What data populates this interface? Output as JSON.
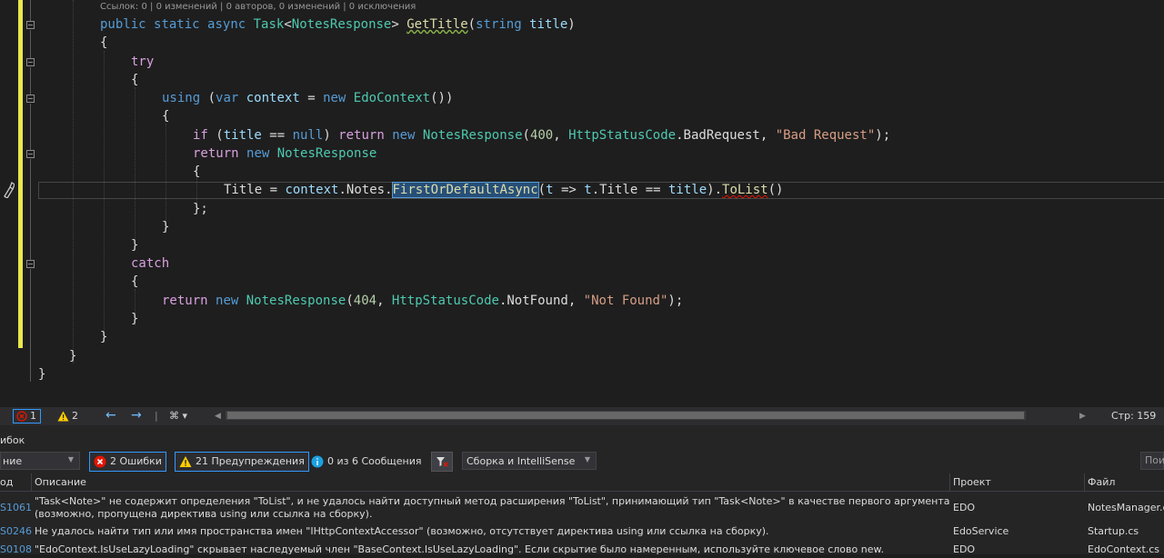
{
  "editor": {
    "codelens": "Ссылок: 0 | 0 изменений | 0 авторов, 0 изменений | 0 исключения",
    "lines": {
      "l1_kw1": "public",
      "l1_kw2": "static",
      "l1_kw3": "async",
      "l1_type": "Task",
      "l1_generic": "NotesResponse",
      "l1_method": "GetTitle",
      "l1_ptype": "string",
      "l1_pname": "title",
      "try_kw": "try",
      "using_kw": "using",
      "var_kw": "var",
      "context_var": "context",
      "new_kw": "new",
      "edo_type": "EdoContext",
      "if_kw": "if",
      "title_param": "title",
      "null_kw": "null",
      "return_kw": "return",
      "notes_resp": "NotesResponse",
      "num_400": "400",
      "http_status": "HttpStatusCode",
      "bad_request_member": "BadRequest",
      "bad_request_str": "\"Bad Request\"",
      "title_prop": "Title",
      "notes_prop": "Notes",
      "first_method": "FirstOrDefaultAsync",
      "lambda_t": "t",
      "lambda_title": "Title",
      "tolist_method": "ToList",
      "catch_kw": "catch",
      "num_404": "404",
      "not_found_member": "NotFound",
      "not_found_str": "\"Not Found\""
    }
  },
  "statusbar": {
    "errors_count": "1",
    "warnings_count": "2",
    "position": "Стр: 159"
  },
  "error_panel": {
    "title": "ибок",
    "filter_value": "ние",
    "errors_button": "2 Ошибки",
    "warnings_button": "21 Предупреждения",
    "messages_button": "0 из 6 Сообщения",
    "build_filter": "Сборка и IntelliSense",
    "search_placeholder": "Пои",
    "columns": {
      "code": "од",
      "description": "Описание",
      "project": "Проект",
      "file": "Файл"
    },
    "rows": [
      {
        "code": "S1061",
        "description": "\"Task<Note>\" не содержит определения \"ToList\", и не удалось найти доступный метод расширения \"ToList\", принимающий тип \"Task<Note>\" в качестве первого аргумента (возможно, пропущена директива using или ссылка на сборку).",
        "project": "EDO",
        "file": "NotesManager.c"
      },
      {
        "code": "S0246",
        "description": "Не удалось найти тип или имя пространства имен \"IHttpContextAccessor\" (возможно, отсутствует директива using или ссылка на сборку).",
        "project": "EdoService",
        "file": "Startup.cs"
      },
      {
        "code": "S0108",
        "description": "\"EdoContext.IsUseLazyLoading\" скрывает наследуемый член \"BaseContext.IsUseLazyLoading\". Если скрытие было намеренным, используйте ключевое слово new.",
        "project": "EDO",
        "file": "EdoContext.cs"
      }
    ]
  },
  "colors": {
    "background": "#1e1e1e",
    "keyword": "#569cd6",
    "control": "#d8a0df",
    "type": "#4ec9b0",
    "method": "#dcdcaa",
    "string": "#d69d85",
    "number": "#b5cea8",
    "changebar": "#e9e84a",
    "error": "#e51400"
  }
}
